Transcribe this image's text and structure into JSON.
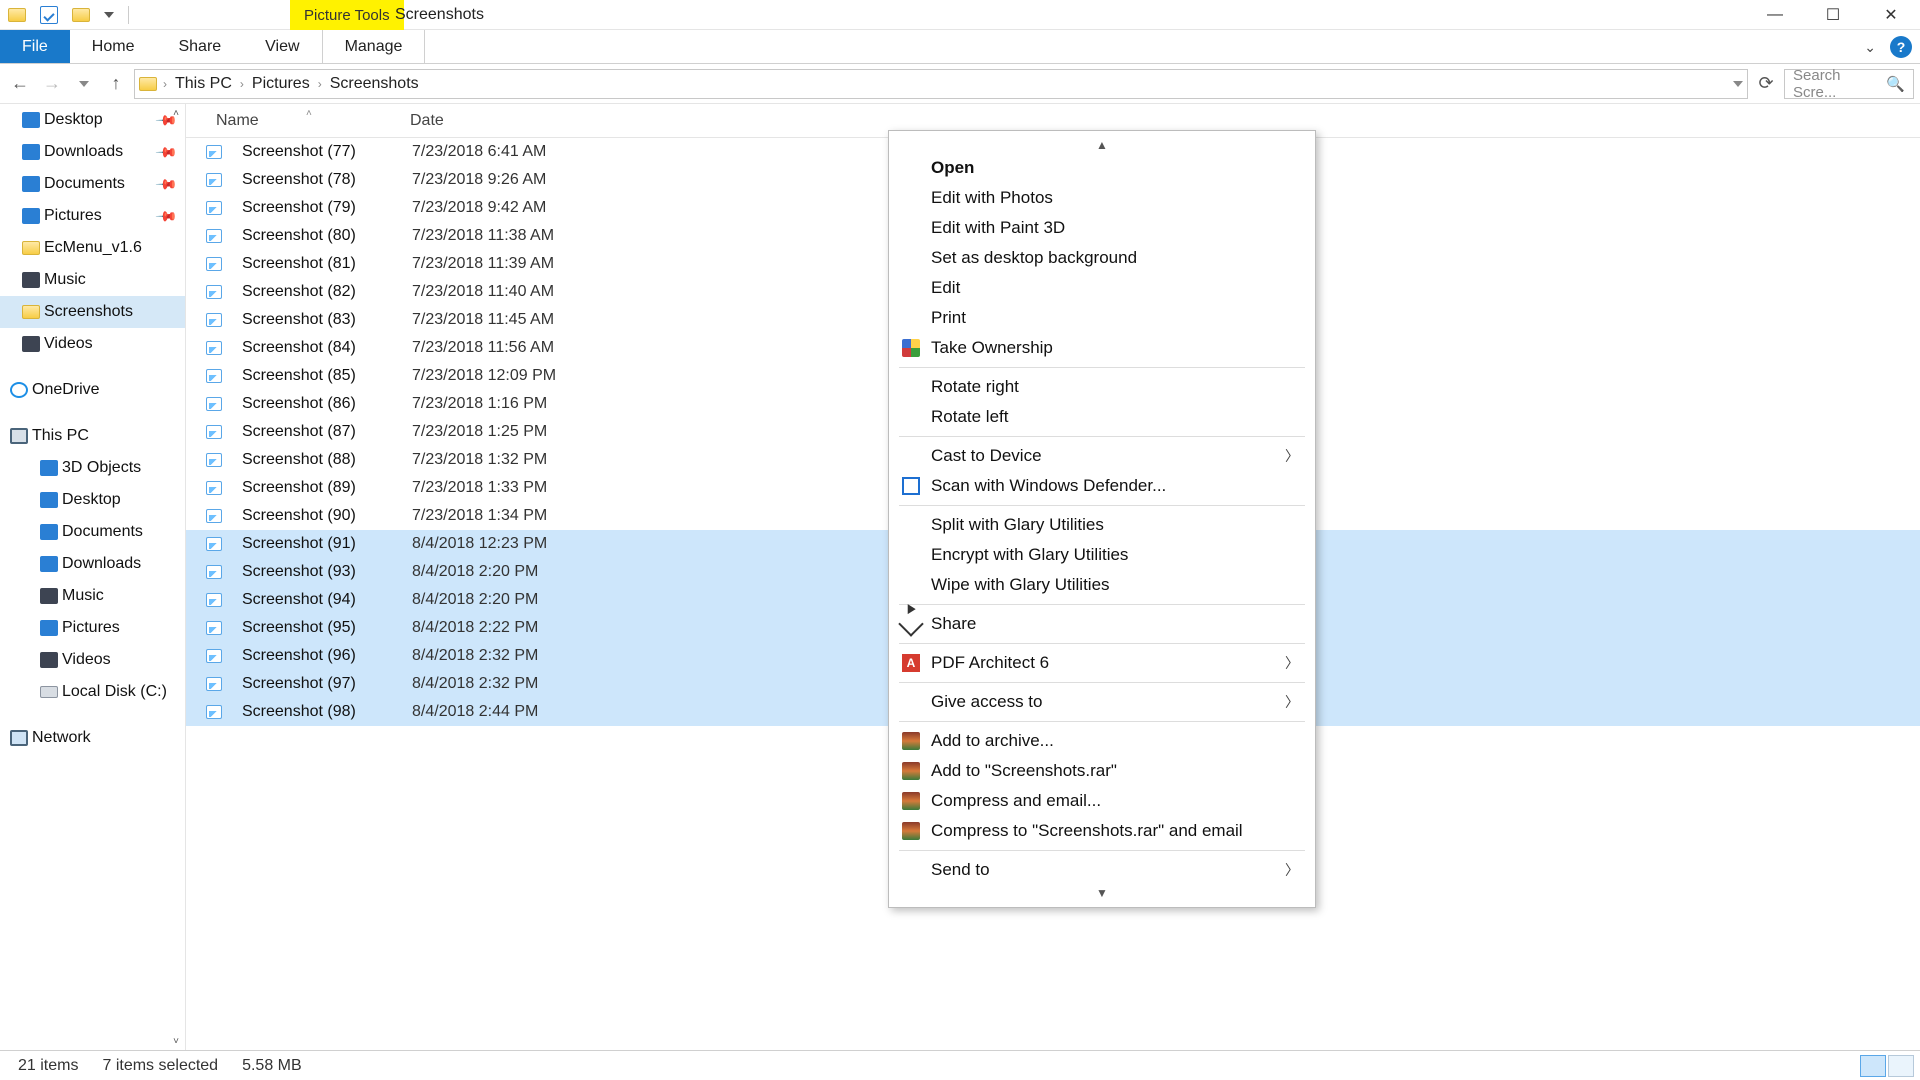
{
  "window": {
    "context_tab": "Picture Tools",
    "title": "Screenshots"
  },
  "ribbon": {
    "tabs": [
      "File",
      "Home",
      "Share",
      "View",
      "Manage"
    ]
  },
  "address": {
    "crumbs": [
      "This PC",
      "Pictures",
      "Screenshots"
    ],
    "search_placeholder": "Search Scre..."
  },
  "navpane": {
    "quick": [
      {
        "label": "Desktop",
        "pinned": true,
        "ico": "blue"
      },
      {
        "label": "Downloads",
        "pinned": true,
        "ico": "blue"
      },
      {
        "label": "Documents",
        "pinned": true,
        "ico": "blue"
      },
      {
        "label": "Pictures",
        "pinned": true,
        "ico": "blue"
      },
      {
        "label": "EcMenu_v1.6",
        "pinned": false,
        "ico": "folder"
      },
      {
        "label": "Music",
        "pinned": false,
        "ico": "dark"
      },
      {
        "label": "Screenshots",
        "pinned": false,
        "ico": "folder",
        "selected": true
      },
      {
        "label": "Videos",
        "pinned": false,
        "ico": "dark"
      }
    ],
    "onedrive_label": "OneDrive",
    "thispc_label": "This PC",
    "thispc": [
      {
        "label": "3D Objects",
        "ico": "blue"
      },
      {
        "label": "Desktop",
        "ico": "blue"
      },
      {
        "label": "Documents",
        "ico": "blue"
      },
      {
        "label": "Downloads",
        "ico": "blue"
      },
      {
        "label": "Music",
        "ico": "dark"
      },
      {
        "label": "Pictures",
        "ico": "blue"
      },
      {
        "label": "Videos",
        "ico": "dark"
      },
      {
        "label": "Local Disk (C:)",
        "ico": "disk"
      }
    ],
    "network_label": "Network"
  },
  "columns": {
    "name": "Name",
    "date": "Date"
  },
  "files": [
    {
      "name": "Screenshot (77)",
      "date": "7/23/2018 6:41 AM",
      "selected": false
    },
    {
      "name": "Screenshot (78)",
      "date": "7/23/2018 9:26 AM",
      "selected": false
    },
    {
      "name": "Screenshot (79)",
      "date": "7/23/2018 9:42 AM",
      "selected": false
    },
    {
      "name": "Screenshot (80)",
      "date": "7/23/2018 11:38 AM",
      "selected": false
    },
    {
      "name": "Screenshot (81)",
      "date": "7/23/2018 11:39 AM",
      "selected": false
    },
    {
      "name": "Screenshot (82)",
      "date": "7/23/2018 11:40 AM",
      "selected": false
    },
    {
      "name": "Screenshot (83)",
      "date": "7/23/2018 11:45 AM",
      "selected": false
    },
    {
      "name": "Screenshot (84)",
      "date": "7/23/2018 11:56 AM",
      "selected": false
    },
    {
      "name": "Screenshot (85)",
      "date": "7/23/2018 12:09 PM",
      "selected": false
    },
    {
      "name": "Screenshot (86)",
      "date": "7/23/2018 1:16 PM",
      "selected": false
    },
    {
      "name": "Screenshot (87)",
      "date": "7/23/2018 1:25 PM",
      "selected": false
    },
    {
      "name": "Screenshot (88)",
      "date": "7/23/2018 1:32 PM",
      "selected": false
    },
    {
      "name": "Screenshot (89)",
      "date": "7/23/2018 1:33 PM",
      "selected": false
    },
    {
      "name": "Screenshot (90)",
      "date": "7/23/2018 1:34 PM",
      "selected": false
    },
    {
      "name": "Screenshot (91)",
      "date": "8/4/2018 12:23 PM",
      "selected": true
    },
    {
      "name": "Screenshot (93)",
      "date": "8/4/2018 2:20 PM",
      "selected": true
    },
    {
      "name": "Screenshot (94)",
      "date": "8/4/2018 2:20 PM",
      "selected": true
    },
    {
      "name": "Screenshot (95)",
      "date": "8/4/2018 2:22 PM",
      "selected": true
    },
    {
      "name": "Screenshot (96)",
      "date": "8/4/2018 2:32 PM",
      "selected": true
    },
    {
      "name": "Screenshot (97)",
      "date": "8/4/2018 2:32 PM",
      "selected": true
    },
    {
      "name": "Screenshot (98)",
      "date": "8/4/2018 2:44 PM",
      "selected": true
    }
  ],
  "context_menu": [
    {
      "type": "scroll-up"
    },
    {
      "type": "item",
      "label": "Open",
      "bold": true
    },
    {
      "type": "item",
      "label": "Edit with Photos"
    },
    {
      "type": "item",
      "label": "Edit with Paint 3D"
    },
    {
      "type": "item",
      "label": "Set as desktop background"
    },
    {
      "type": "item",
      "label": "Edit"
    },
    {
      "type": "item",
      "label": "Print"
    },
    {
      "type": "item",
      "label": "Take Ownership",
      "icon": "shield"
    },
    {
      "type": "sep"
    },
    {
      "type": "item",
      "label": "Rotate right"
    },
    {
      "type": "item",
      "label": "Rotate left"
    },
    {
      "type": "sep"
    },
    {
      "type": "item",
      "label": "Cast to Device",
      "submenu": true
    },
    {
      "type": "item",
      "label": "Scan with Windows Defender...",
      "icon": "defender"
    },
    {
      "type": "sep"
    },
    {
      "type": "item",
      "label": "Split with Glary Utilities"
    },
    {
      "type": "item",
      "label": "Encrypt with Glary Utilities"
    },
    {
      "type": "item",
      "label": "Wipe with Glary Utilities"
    },
    {
      "type": "sep"
    },
    {
      "type": "item",
      "label": "Share",
      "icon": "share"
    },
    {
      "type": "sep"
    },
    {
      "type": "item",
      "label": "PDF Architect 6",
      "icon": "pdf",
      "submenu": true
    },
    {
      "type": "sep"
    },
    {
      "type": "item",
      "label": "Give access to",
      "submenu": true
    },
    {
      "type": "sep"
    },
    {
      "type": "item",
      "label": "Add to archive...",
      "icon": "rar"
    },
    {
      "type": "item",
      "label": "Add to \"Screenshots.rar\"",
      "icon": "rar"
    },
    {
      "type": "item",
      "label": "Compress and email...",
      "icon": "rar"
    },
    {
      "type": "item",
      "label": "Compress to \"Screenshots.rar\" and email",
      "icon": "rar"
    },
    {
      "type": "sep"
    },
    {
      "type": "item",
      "label": "Send to",
      "submenu": true
    },
    {
      "type": "scroll-down"
    }
  ],
  "status": {
    "items": "21 items",
    "selected": "7 items selected",
    "size": "5.58 MB"
  }
}
